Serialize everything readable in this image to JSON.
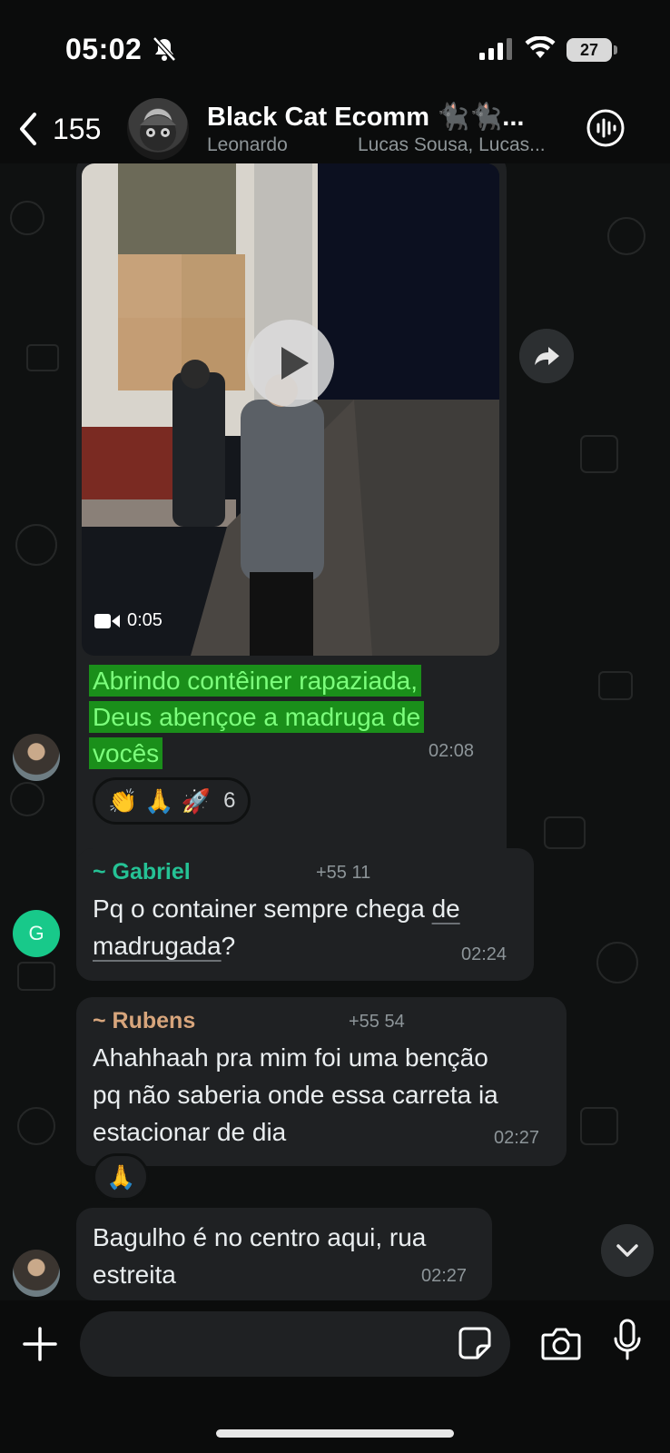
{
  "status_bar": {
    "time": "05:02",
    "battery": "27"
  },
  "header": {
    "back_count": "155",
    "title": "Black Cat Ecomm 🐈‍⬛🐈‍⬛...",
    "subtitle_left": "Leonardo",
    "subtitle_right": "Lucas Sousa, Lucas..."
  },
  "messages": [
    {
      "type": "video",
      "duration": "0:05",
      "caption_lines": [
        "Abrindo contêiner rapaziada,",
        "Deus abençoe a madruga de",
        "vocês"
      ],
      "time": "02:08",
      "reactions": [
        "👏",
        "🙏",
        "🚀"
      ],
      "reaction_count": "6"
    },
    {
      "type": "text",
      "sender": "~ Gabriel",
      "phone": "+55 11",
      "avatar_letter": "G",
      "text_part1": "Pq o container sempre chega ",
      "text_link1": "de",
      "text_link2": "madrugada",
      "text_part2": "?",
      "time": "02:24",
      "sender_color": "#25c295"
    },
    {
      "type": "text",
      "sender": "~ Rubens",
      "phone": "+55 54",
      "text_lines": [
        "Ahahhaah pra mim foi uma benção",
        "pq não saberia onde essa carreta ia",
        "estacionar de dia"
      ],
      "time": "02:27",
      "reactions": [
        "🙏"
      ],
      "sender_color": "#d7a57c"
    },
    {
      "type": "text",
      "text_lines": [
        "Bagulho é no centro aqui, rua",
        "estreita"
      ],
      "time": "02:27"
    }
  ],
  "input": {
    "placeholder": ""
  },
  "icons": {
    "back": "chevron-left-icon",
    "call": "voice-call-icon",
    "forward": "forward-icon",
    "play": "play-icon",
    "scroll": "chevron-down-icon",
    "plus": "plus-icon",
    "sticker": "sticker-icon",
    "camera": "camera-icon",
    "mic": "microphone-icon"
  }
}
